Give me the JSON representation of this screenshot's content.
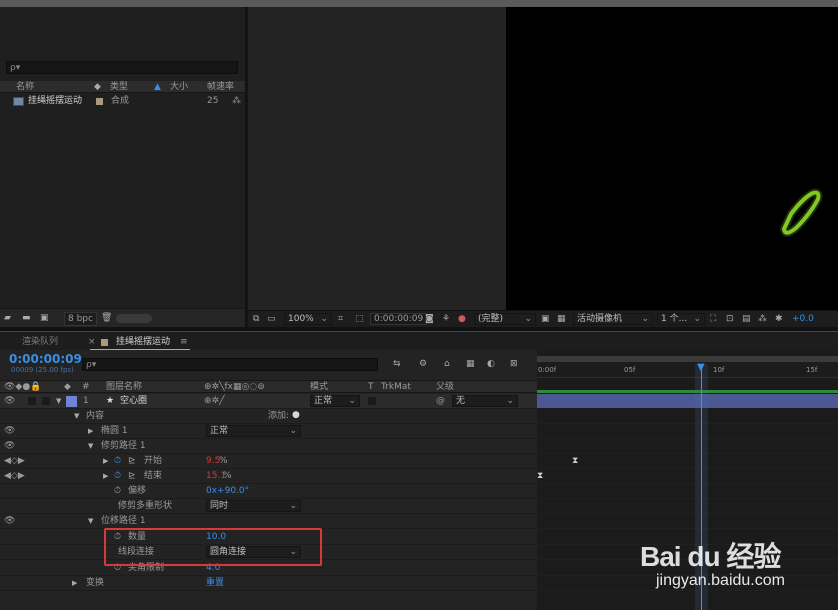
{
  "project": {
    "search_placeholder": "ρ▾",
    "columns": {
      "name": "名称",
      "type": "类型",
      "size": "大小",
      "framerate": "帧速率"
    },
    "item": {
      "name": "挂绳摇摆运动",
      "type": "合成",
      "framerate": "25"
    },
    "footer": {
      "bpc": "8 bpc"
    }
  },
  "viewer_bar": {
    "zoom": "100%",
    "timecode": "0:00:00:09",
    "quality": "(完整)",
    "camera": "活动摄像机",
    "views": "1 个...",
    "exposure": "+0.0"
  },
  "timeline": {
    "tab_render": "渲染队列",
    "tab_comp": "挂绳摇摆运动",
    "timecode": "0:00:00:09",
    "timecode_sub": "00009 (25.00 fps)",
    "search_placeholder": "ρ▾",
    "columns": {
      "num": "#",
      "layer_name": "图层名称",
      "mode": "模式",
      "t": "T",
      "trkmat": "TrkMat",
      "parent": "父级"
    },
    "ruler": [
      "0:00f",
      "05f",
      "10f",
      "15f"
    ],
    "layer": {
      "num": "1",
      "name": "空心圈",
      "mode": "正常",
      "parent": "无"
    },
    "rows": {
      "content": "内容",
      "add": "添加:",
      "ellipse": "椭圆 1",
      "ellipse_mode": "正常",
      "trim": "修剪路径 1",
      "start_label": "开始",
      "start_value": "9.5",
      "start_unit": "%",
      "end_label": "结束",
      "end_value": "15.1",
      "end_unit": "%",
      "offset_label": "偏移",
      "offset_value": "0x+90.0°",
      "trim_multi_label": "修剪多重形状",
      "trim_multi_value": "同时",
      "offset_path": "位移路径 1",
      "amount_label": "数量",
      "amount_value": "10.0",
      "line_join_label": "线段连接",
      "line_join_value": "圆角连接",
      "miter_label": "尖角限制",
      "miter_value": "4.0",
      "transform_label": "变换",
      "transform_value": "重置"
    }
  },
  "watermark": {
    "logo": "Bai du 经验",
    "url": "jingyan.baidu.com"
  },
  "colors": {
    "accent_blue": "#3a8ee6",
    "stroke_green": "#9be02a",
    "layer_bar": "#4b5893",
    "highlight_red": "#d63a3a"
  }
}
